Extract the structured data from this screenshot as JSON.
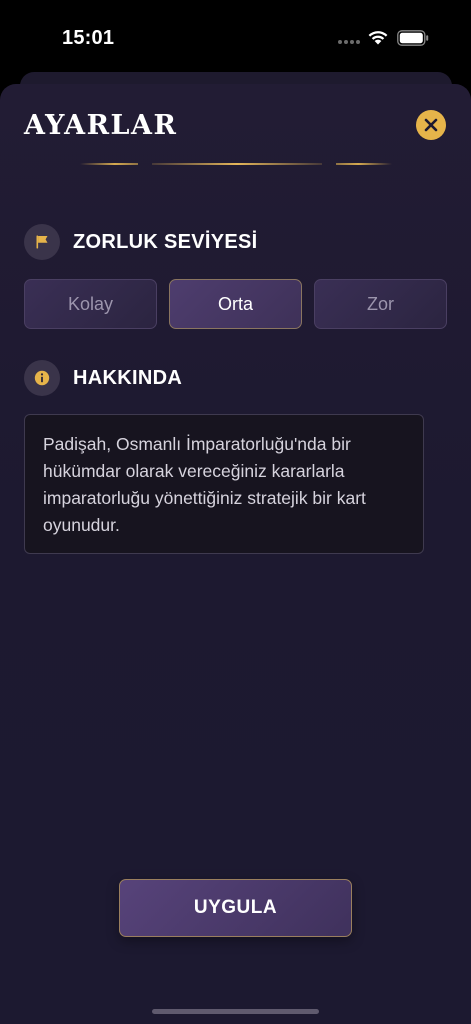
{
  "status_bar": {
    "time": "15:01",
    "icons": [
      "signal-icon",
      "wifi-icon",
      "battery-icon"
    ]
  },
  "header": {
    "title": "AYARLAR",
    "close_icon": "close-icon"
  },
  "difficulty": {
    "title": "ZORLUK SEVİYESİ",
    "icon": "flag-icon",
    "options": [
      {
        "label": "Kolay",
        "selected": false
      },
      {
        "label": "Orta",
        "selected": true
      },
      {
        "label": "Zor",
        "selected": false
      }
    ]
  },
  "about": {
    "title": "HAKKINDA",
    "icon": "info-icon",
    "text": "Padişah, Osmanlı İmparatorluğu'nda bir hükümdar olarak vereceğiniz kararlarla imparatorluğu yönettiğiniz stratejik bir kart oyunudur."
  },
  "actions": {
    "apply_label": "UYGULA"
  },
  "colors": {
    "accent_gold": "#e6b44a",
    "background": "#1d1930",
    "selected_option": "#4e3d6e"
  }
}
